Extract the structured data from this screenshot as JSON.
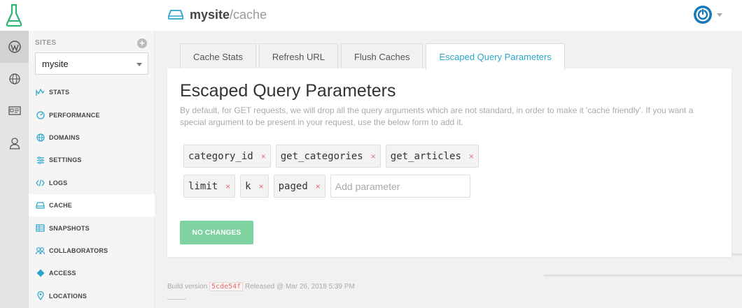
{
  "topbar": {
    "site_name": "mysite",
    "site_path": "/cache"
  },
  "sidebar": {
    "sites_label": "SITES",
    "selected_site": "mysite",
    "items": [
      {
        "label": "STATS",
        "icon": "stats-icon"
      },
      {
        "label": "PERFORMANCE",
        "icon": "performance-icon"
      },
      {
        "label": "DOMAINS",
        "icon": "globe-icon"
      },
      {
        "label": "SETTINGS",
        "icon": "settings-icon"
      },
      {
        "label": "LOGS",
        "icon": "code-icon"
      },
      {
        "label": "CACHE",
        "icon": "drive-icon"
      },
      {
        "label": "SNAPSHOTS",
        "icon": "snapshots-icon"
      },
      {
        "label": "COLLABORATORS",
        "icon": "collaborators-icon"
      },
      {
        "label": "ACCESS",
        "icon": "access-icon"
      },
      {
        "label": "LOCATIONS",
        "icon": "location-icon"
      }
    ],
    "active_item": "CACHE"
  },
  "tabs": [
    {
      "label": "Cache Stats"
    },
    {
      "label": "Refresh URL"
    },
    {
      "label": "Flush Caches"
    },
    {
      "label": "Escaped Query Parameters"
    }
  ],
  "active_tab": "Escaped Query Parameters",
  "panel": {
    "title": "Escaped Query Parameters",
    "description": "By default, for GET requests, we will drop all the query arguments which are not standard, in order to make it 'cache friendly'. If you want a special argument to be present in your request, use the below form to add it.",
    "parameters_row1": [
      "category_id",
      "get_categories",
      "get_articles"
    ],
    "parameters_row2": [
      "limit",
      "k",
      "paged"
    ],
    "remove_glyph": "×",
    "add_placeholder": "Add parameter",
    "button_label": "NO CHANGES"
  },
  "footer": {
    "prefix": "Build version",
    "version": "5cde54f",
    "released": "Released @ Mar 26, 2018 5:39 PM"
  },
  "colors": {
    "accent": "#2ba6cb",
    "brand_green": "#2bb673",
    "button_disabled": "#7fd3a1",
    "remove_x": "#e07070"
  }
}
